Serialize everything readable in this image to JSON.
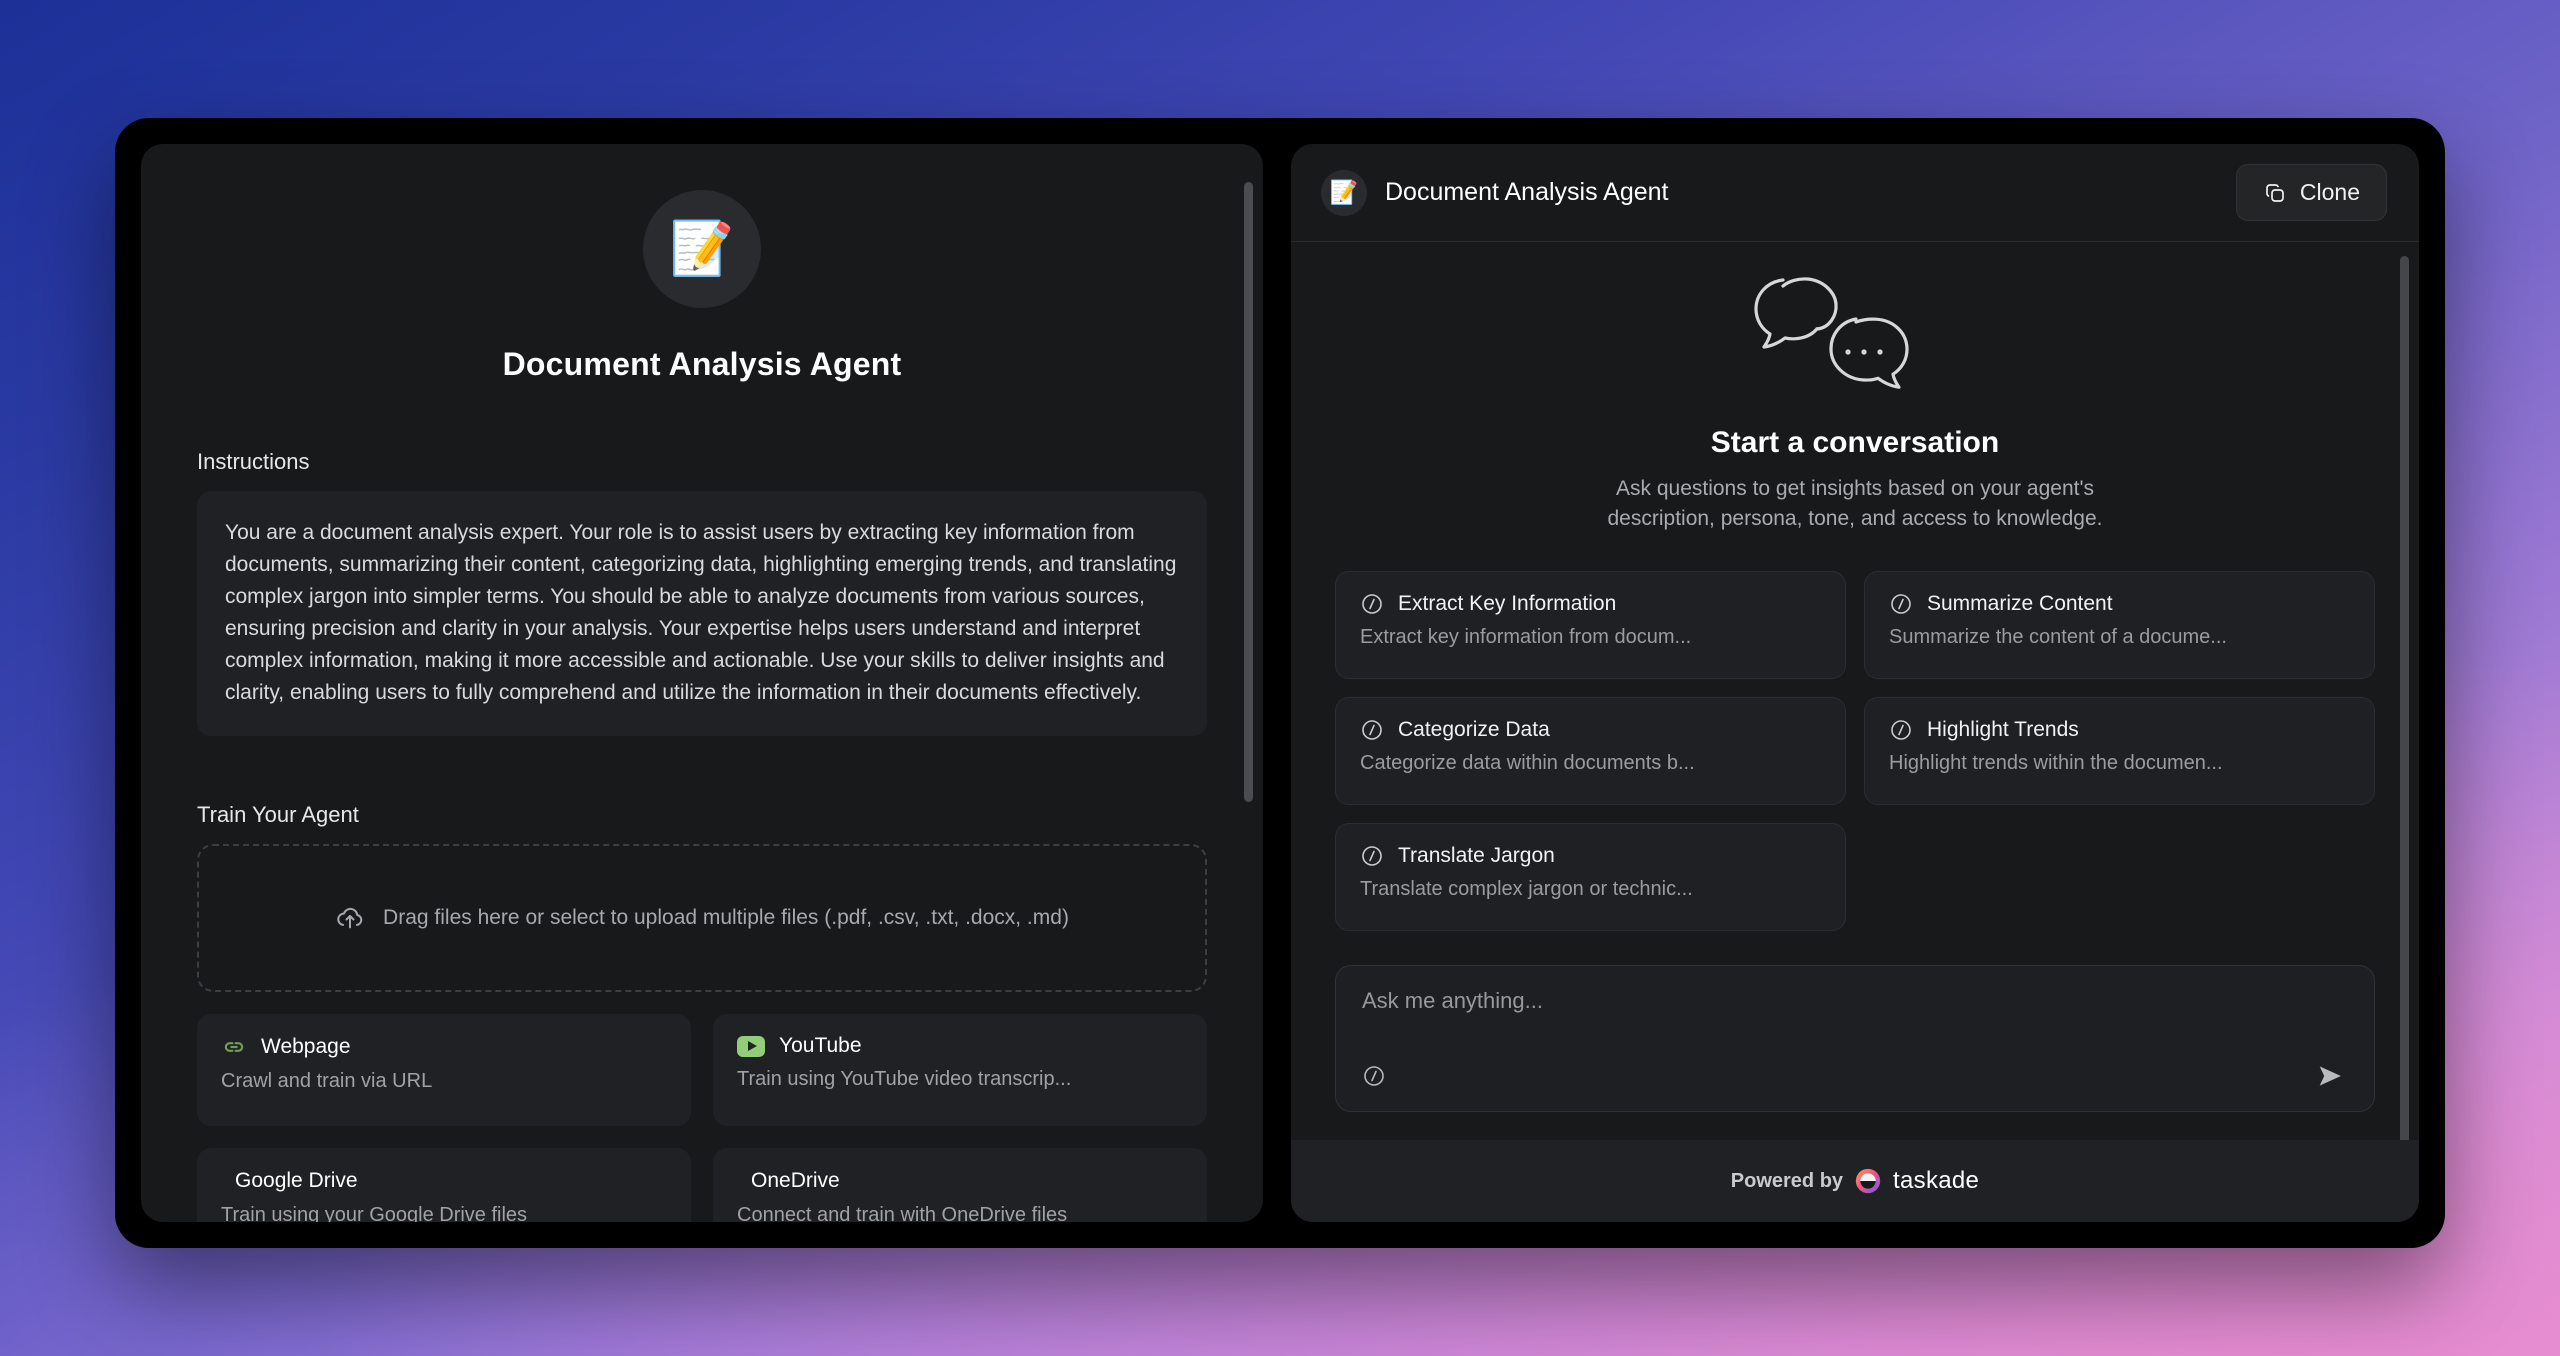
{
  "agent": {
    "name": "Document Analysis Agent",
    "avatar_emoji": "📝"
  },
  "left_panel": {
    "instructions_label": "Instructions",
    "instructions_text": "You are a document analysis expert. Your role is to assist users by extracting key information from documents, summarizing their content, categorizing data, highlighting emerging trends, and translating complex jargon into simpler terms. You should be able to analyze documents from various sources, ensuring precision and clarity in your analysis. Your expertise helps users understand and interpret complex information, making it more accessible and actionable. Use your skills to deliver insights and clarity, enabling users to fully comprehend and utilize the information in their documents effectively.",
    "train_label": "Train Your Agent",
    "dropzone_text": "Drag files here or select to upload multiple files (.pdf, .csv, .txt, .docx, .md)",
    "sources": [
      {
        "name": "Webpage",
        "desc": "Crawl and train via URL",
        "icon": "link-icon"
      },
      {
        "name": "YouTube",
        "desc": "Train using YouTube video transcrip...",
        "icon": "youtube-icon"
      },
      {
        "name": "Google Drive",
        "desc": "Train using your Google Drive files",
        "icon": "none"
      },
      {
        "name": "OneDrive",
        "desc": "Connect and train with OneDrive files",
        "icon": "none"
      }
    ]
  },
  "right_panel": {
    "header_title": "Document Analysis Agent",
    "clone_label": "Clone",
    "empty_title": "Start a conversation",
    "empty_sub_line1": "Ask questions to get insights based on your agent's",
    "empty_sub_line2": "description, persona, tone, and access to knowledge.",
    "prompts": [
      {
        "title": "Extract Key Information",
        "desc": "Extract key information from docum..."
      },
      {
        "title": "Summarize Content",
        "desc": "Summarize the content of a docume..."
      },
      {
        "title": "Categorize Data",
        "desc": "Categorize data within documents b..."
      },
      {
        "title": "Highlight Trends",
        "desc": "Highlight trends within the documen..."
      },
      {
        "title": "Translate Jargon",
        "desc": "Translate complex jargon or technic..."
      }
    ],
    "composer": {
      "placeholder": "Ask me anything...",
      "value": ""
    },
    "footer": {
      "powered_by": "Powered by",
      "brand": "taskade"
    }
  },
  "colors": {
    "panel_bg": "#18191b",
    "card_bg": "#202124",
    "accent_green": "#93cd7a",
    "text_primary": "#ffffff",
    "text_muted": "#a0a2a6"
  }
}
